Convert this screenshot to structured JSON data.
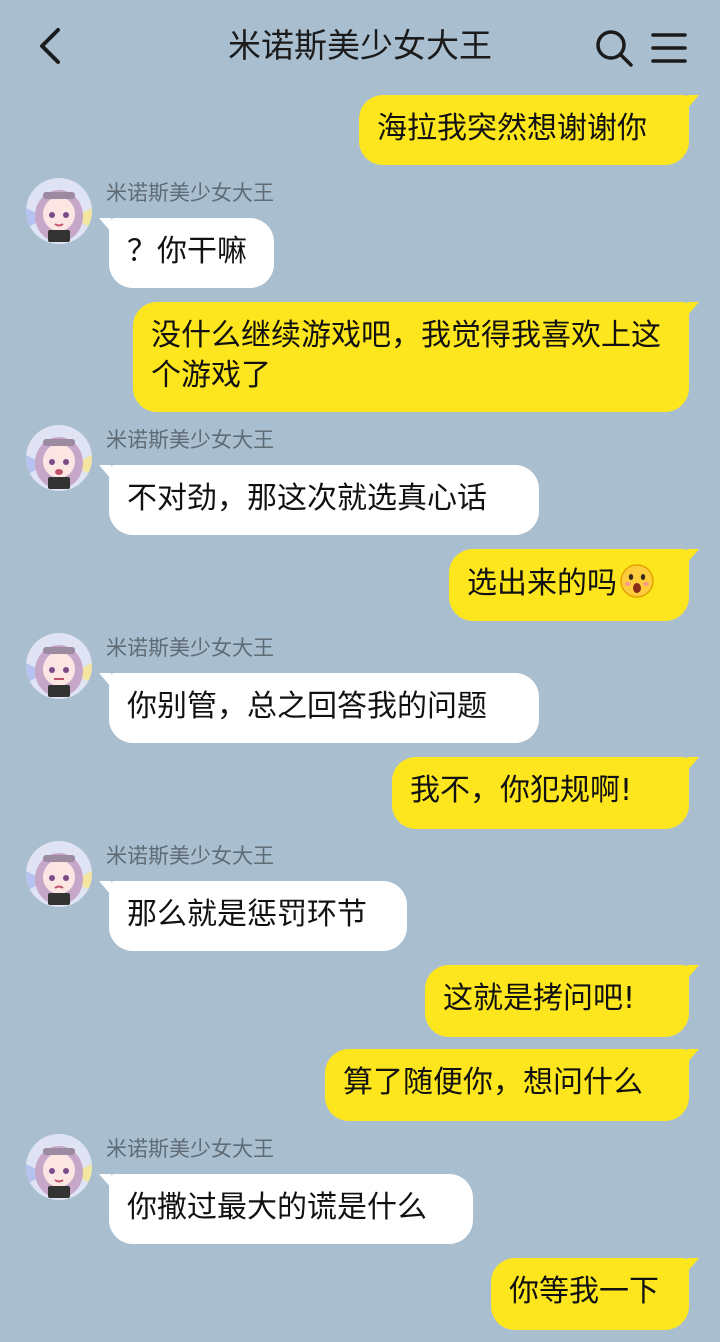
{
  "header": {
    "title": "米诺斯美少女大王",
    "back_icon": "chevron-left-icon",
    "search_icon": "search-icon",
    "menu_icon": "menu-icon"
  },
  "colors": {
    "background": "#a9bfd0",
    "my_bubble": "#fde61d",
    "their_bubble": "#ffffff"
  },
  "messages": [
    {
      "from": "me",
      "text": "海拉我突然想谢谢你"
    },
    {
      "from": "them",
      "sender": "米诺斯美少女大王",
      "text": "？你干嘛"
    },
    {
      "from": "me",
      "text": "没什么继续游戏吧，我觉得我喜欢上这个游戏了"
    },
    {
      "from": "them",
      "sender": "米诺斯美少女大王",
      "text": "不对劲，那这次就选真心话"
    },
    {
      "from": "me",
      "text": "选出来的吗",
      "emoji": "astonished-face-icon"
    },
    {
      "from": "them",
      "sender": "米诺斯美少女大王",
      "text": "你别管，总之回答我的问题"
    },
    {
      "from": "me",
      "text": "我不，你犯规啊!"
    },
    {
      "from": "them",
      "sender": "米诺斯美少女大王",
      "text": "那么就是惩罚环节"
    },
    {
      "from": "me",
      "text": "这就是拷问吧!"
    },
    {
      "from": "me",
      "text": "算了随便你，想问什么"
    },
    {
      "from": "them",
      "sender": "米诺斯美少女大王",
      "text": "你撒过最大的谎是什么"
    },
    {
      "from": "me",
      "text": "你等我一下"
    }
  ]
}
